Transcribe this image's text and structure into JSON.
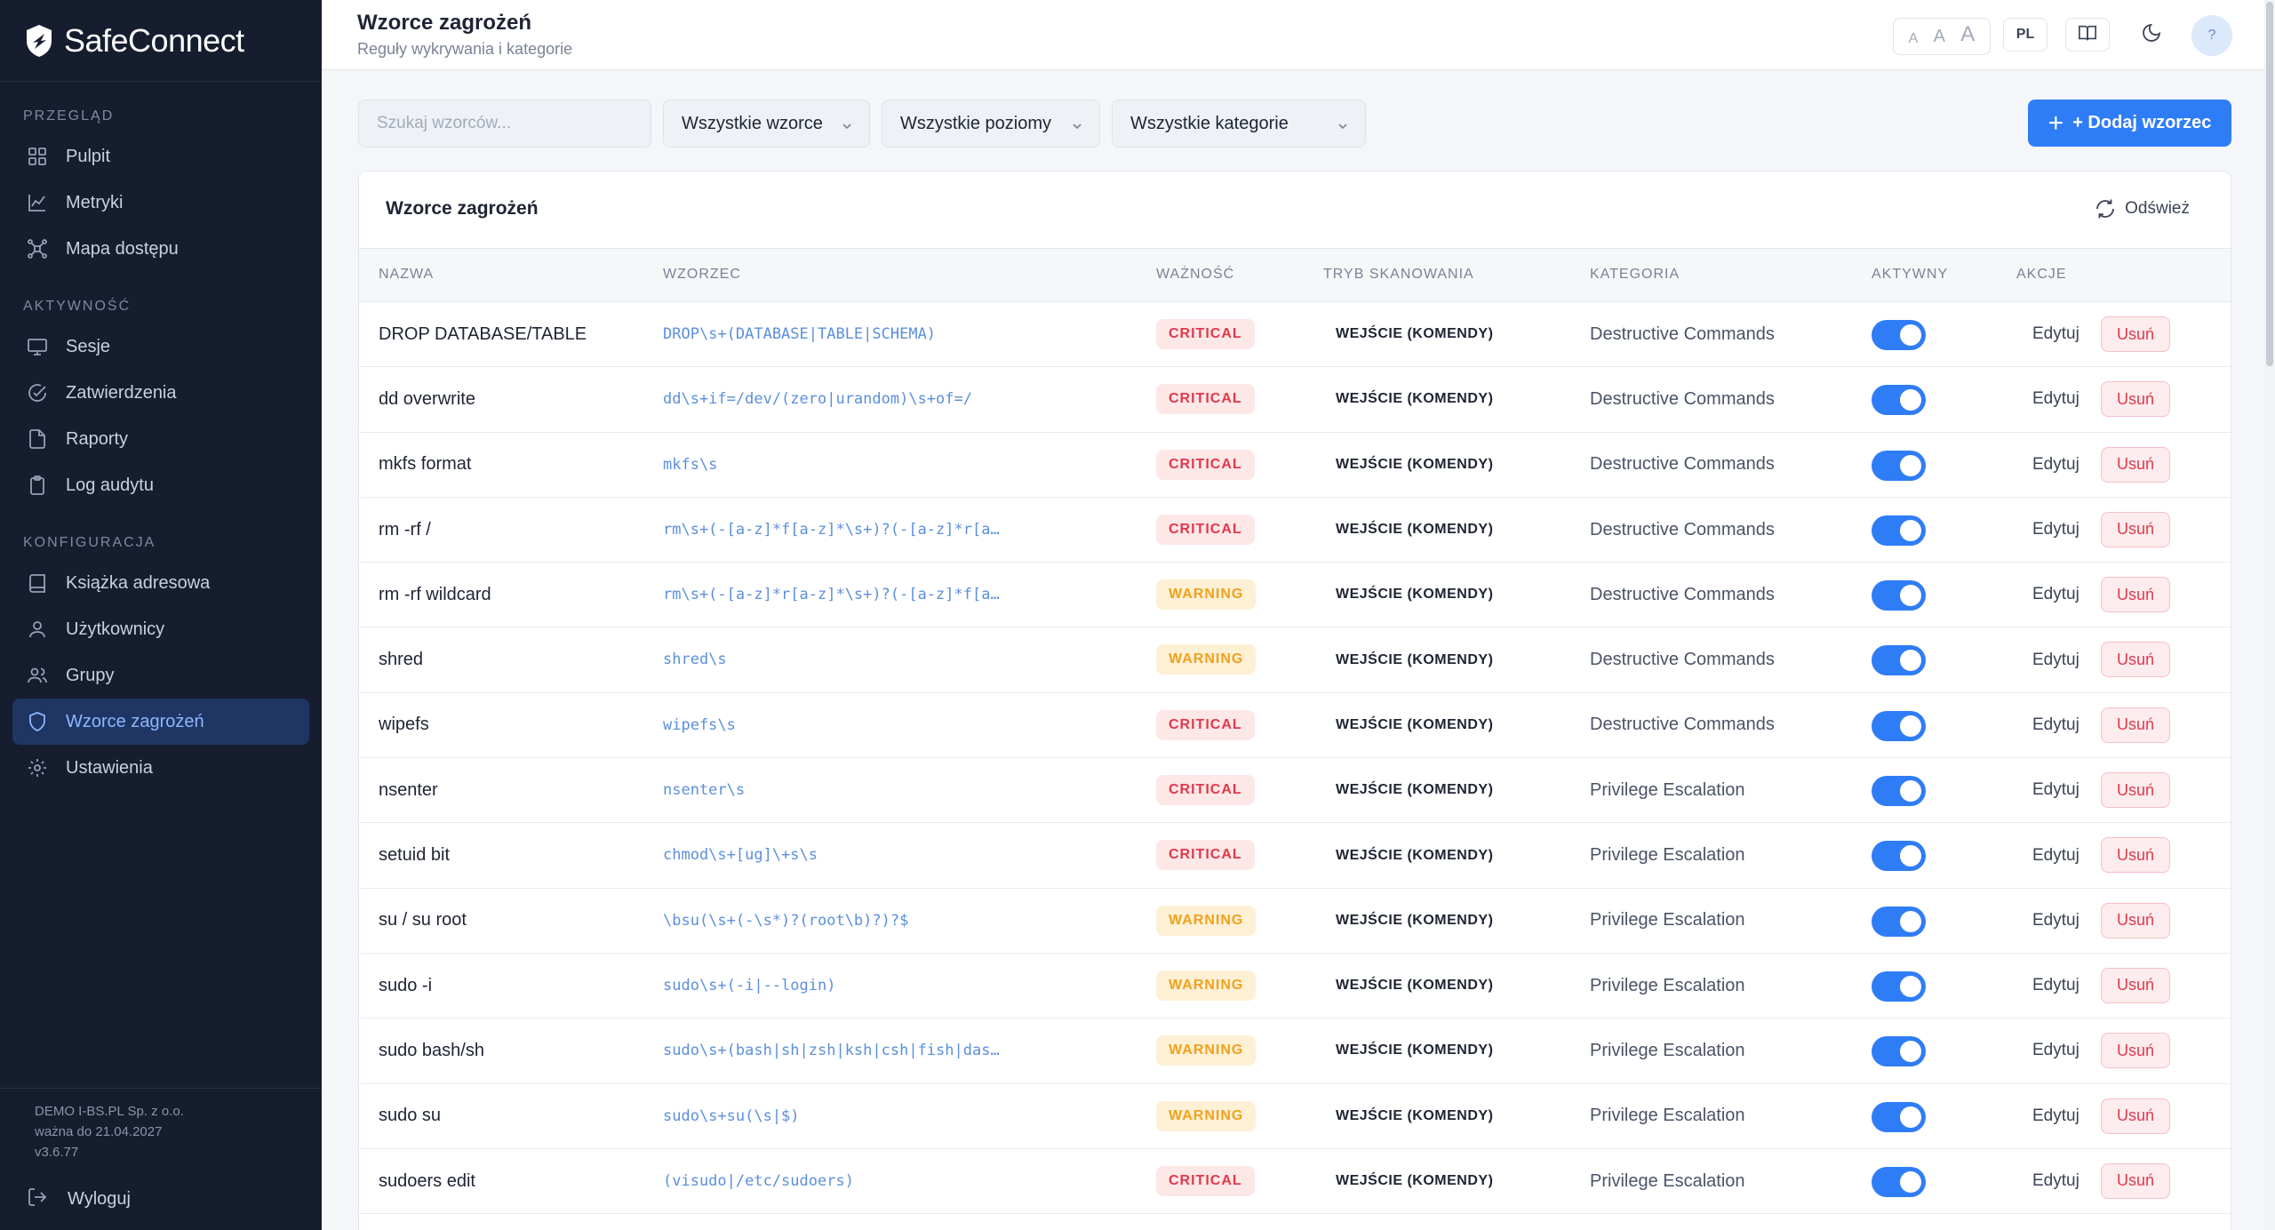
{
  "app": {
    "brand": "SafeConnect"
  },
  "sidebar": {
    "sections": [
      {
        "title": "PRZEGLĄD",
        "items": [
          {
            "label": "Pulpit",
            "icon": "dashboard-icon"
          },
          {
            "label": "Metryki",
            "icon": "chart-icon"
          },
          {
            "label": "Mapa dostępu",
            "icon": "network-map-icon"
          }
        ]
      },
      {
        "title": "AKTYWNOŚĆ",
        "items": [
          {
            "label": "Sesje",
            "icon": "monitor-icon"
          },
          {
            "label": "Zatwierdzenia",
            "icon": "check-circle-icon"
          },
          {
            "label": "Raporty",
            "icon": "file-icon"
          },
          {
            "label": "Log audytu",
            "icon": "clipboard-icon"
          }
        ]
      },
      {
        "title": "KONFIGURACJA",
        "items": [
          {
            "label": "Książka adresowa",
            "icon": "book-icon"
          },
          {
            "label": "Użytkownicy",
            "icon": "user-icon"
          },
          {
            "label": "Grupy",
            "icon": "users-icon"
          },
          {
            "label": "Wzorce zagrożeń",
            "icon": "shield-icon",
            "active": true
          },
          {
            "label": "Ustawienia",
            "icon": "gear-icon"
          }
        ]
      }
    ],
    "license_company": "DEMO I-BS.PL Sp. z o.o.",
    "license_valid": "ważna do 21.04.2027",
    "version": "v3.6.77",
    "logout_label": "Wyloguj"
  },
  "header": {
    "title": "Wzorce zagrożeń",
    "subtitle": "Reguły wykrywania i kategorie",
    "font_sizes": [
      "A",
      "A",
      "A"
    ],
    "lang": "PL",
    "help": "?"
  },
  "toolbar": {
    "search_placeholder": "Szukaj wzorców...",
    "filter_patterns": "Wszystkie wzorce",
    "filter_levels": "Wszystkie poziomy",
    "filter_categories": "Wszystkie kategorie",
    "add_label": "+ Dodaj wzorzec"
  },
  "card": {
    "title": "Wzorce zagrożeń",
    "refresh_label": "Odśwież",
    "columns": [
      "NAZWA",
      "WZORZEC",
      "WAŻNOŚĆ",
      "TRYB SKANOWANIA",
      "KATEGORIA",
      "AKTYWNY",
      "AKCJE"
    ],
    "edit_label": "Edytuj",
    "delete_label": "Usuń",
    "rows": [
      {
        "name": "DROP DATABASE/TABLE",
        "pattern": "DROP\\s+(DATABASE|TABLE|SCHEMA)",
        "severity": "CRITICAL",
        "mode": "WEJŚCIE (KOMENDY)",
        "category": "Destructive Commands",
        "active": true
      },
      {
        "name": "dd overwrite",
        "pattern": "dd\\s+if=/dev/(zero|urandom)\\s+of=/",
        "severity": "CRITICAL",
        "mode": "WEJŚCIE (KOMENDY)",
        "category": "Destructive Commands",
        "active": true
      },
      {
        "name": "mkfs format",
        "pattern": "mkfs\\s",
        "severity": "CRITICAL",
        "mode": "WEJŚCIE (KOMENDY)",
        "category": "Destructive Commands",
        "active": true
      },
      {
        "name": "rm -rf /",
        "pattern": "rm\\s+(-[a-z]*f[a-z]*\\s+)?(-[a-z]*r[a…",
        "severity": "CRITICAL",
        "mode": "WEJŚCIE (KOMENDY)",
        "category": "Destructive Commands",
        "active": true
      },
      {
        "name": "rm -rf wildcard",
        "pattern": "rm\\s+(-[a-z]*r[a-z]*\\s+)?(-[a-z]*f[a…",
        "severity": "WARNING",
        "mode": "WEJŚCIE (KOMENDY)",
        "category": "Destructive Commands",
        "active": true
      },
      {
        "name": "shred",
        "pattern": "shred\\s",
        "severity": "WARNING",
        "mode": "WEJŚCIE (KOMENDY)",
        "category": "Destructive Commands",
        "active": true
      },
      {
        "name": "wipefs",
        "pattern": "wipefs\\s",
        "severity": "CRITICAL",
        "mode": "WEJŚCIE (KOMENDY)",
        "category": "Destructive Commands",
        "active": true
      },
      {
        "name": "nsenter",
        "pattern": "nsenter\\s",
        "severity": "CRITICAL",
        "mode": "WEJŚCIE (KOMENDY)",
        "category": "Privilege Escalation",
        "active": true
      },
      {
        "name": "setuid bit",
        "pattern": "chmod\\s+[ug]\\+s\\s",
        "severity": "CRITICAL",
        "mode": "WEJŚCIE (KOMENDY)",
        "category": "Privilege Escalation",
        "active": true
      },
      {
        "name": "su / su root",
        "pattern": "\\bsu(\\s+(-\\s*)?(root\\b)?)?$",
        "severity": "WARNING",
        "mode": "WEJŚCIE (KOMENDY)",
        "category": "Privilege Escalation",
        "active": true
      },
      {
        "name": "sudo -i",
        "pattern": "sudo\\s+(-i|--login)",
        "severity": "WARNING",
        "mode": "WEJŚCIE (KOMENDY)",
        "category": "Privilege Escalation",
        "active": true
      },
      {
        "name": "sudo bash/sh",
        "pattern": "sudo\\s+(bash|sh|zsh|ksh|csh|fish|das…",
        "severity": "WARNING",
        "mode": "WEJŚCIE (KOMENDY)",
        "category": "Privilege Escalation",
        "active": true
      },
      {
        "name": "sudo su",
        "pattern": "sudo\\s+su(\\s|$)",
        "severity": "WARNING",
        "mode": "WEJŚCIE (KOMENDY)",
        "category": "Privilege Escalation",
        "active": true
      },
      {
        "name": "sudoers edit",
        "pattern": "(visudo|/etc/sudoers)",
        "severity": "CRITICAL",
        "mode": "WEJŚCIE (KOMENDY)",
        "category": "Privilege Escalation",
        "active": true
      }
    ]
  },
  "colors": {
    "sidebar_bg": "#161d2e",
    "accent": "#2f7df6",
    "critical": "#e0394a",
    "warning": "#f2a11b"
  }
}
